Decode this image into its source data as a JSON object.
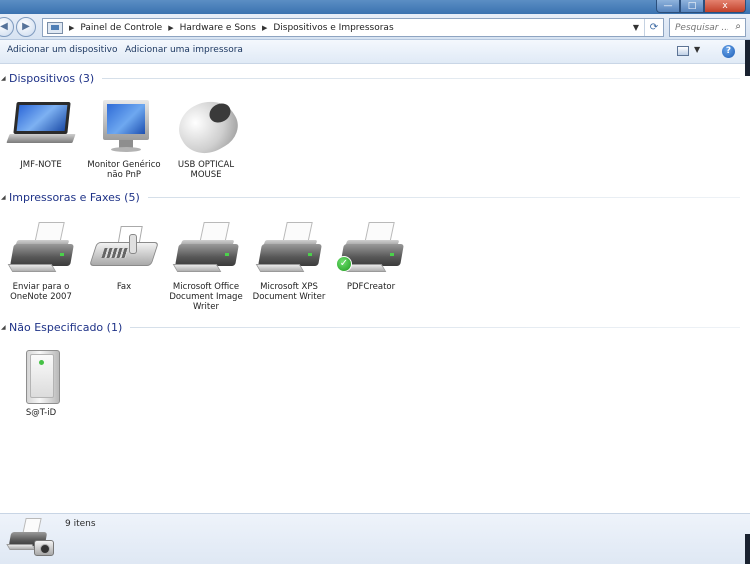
{
  "window": {
    "minimize_glyph": "—",
    "maximize_glyph": "□",
    "close_glyph": "x"
  },
  "navigation": {
    "back_glyph": "◀",
    "forward_glyph": "▶",
    "breadcrumbs": [
      "Painel de Controle",
      "Hardware e Sons",
      "Dispositivos e Impressoras"
    ],
    "search_placeholder": "Pesquisar ...",
    "refresh_glyph": "⟳",
    "dropdown_glyph": "▼",
    "search_glyph": "⌕"
  },
  "toolbar": {
    "add_device": "Adicionar um dispositivo",
    "add_printer": "Adicionar uma impressora",
    "view_dropdown_glyph": "▼",
    "help_glyph": "?"
  },
  "groups": [
    {
      "title": "Dispositivos (3)",
      "items": [
        {
          "label": [
            "JMF-NOTE"
          ],
          "icon": "laptop-icon"
        },
        {
          "label": [
            "Monitor Genérico",
            "não PnP"
          ],
          "icon": "monitor-icon"
        },
        {
          "label": [
            "USB OPTICAL",
            "MOUSE"
          ],
          "icon": "mouse-icon"
        }
      ]
    },
    {
      "title": "Impressoras e Faxes (5)",
      "items": [
        {
          "label": [
            "Enviar para o",
            "OneNote 2007"
          ],
          "icon": "printer-icon"
        },
        {
          "label": [
            "Fax"
          ],
          "icon": "fax-icon"
        },
        {
          "label": [
            "Microsoft Office",
            "Document Image",
            "Writer"
          ],
          "icon": "printer-icon"
        },
        {
          "label": [
            "Microsoft XPS",
            "Document Writer"
          ],
          "icon": "printer-icon"
        },
        {
          "label": [
            "PDFCreator"
          ],
          "icon": "printer-icon",
          "default": true
        }
      ]
    },
    {
      "title": "Não Especificado (1)",
      "items": [
        {
          "label": [
            "S@T-iD"
          ],
          "icon": "computer-tower-icon"
        }
      ]
    }
  ],
  "status": {
    "count_text": "9 itens"
  },
  "colors": {
    "group_title": "#1e3287",
    "toolbar_text": "#1e3962",
    "default_check": "#1e9a1e"
  }
}
